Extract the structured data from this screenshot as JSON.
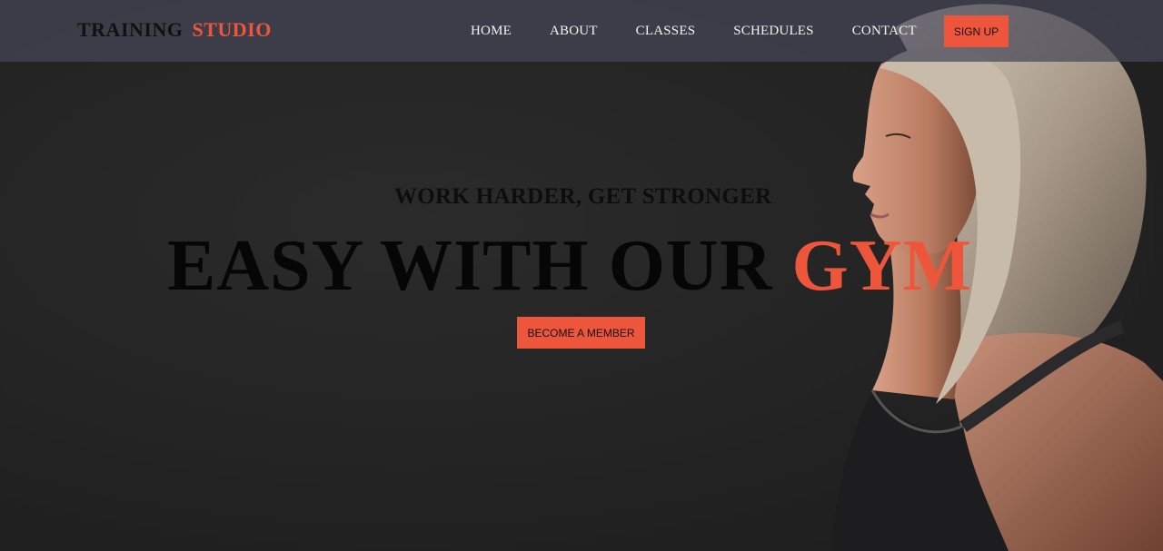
{
  "logo": {
    "part1": "TRAINING",
    "part2": "STUDIO"
  },
  "nav": {
    "items": [
      {
        "label": "HOME"
      },
      {
        "label": "ABOUT"
      },
      {
        "label": "CLASSES"
      },
      {
        "label": "SCHEDULES"
      },
      {
        "label": "CONTACT"
      }
    ],
    "signup_label": "SIGN UP"
  },
  "hero": {
    "subheading": "WORK HARDER, GET STRONGER",
    "headline_main": "EASY WITH OUR",
    "headline_accent": "GYM",
    "cta_label": "BECOME A MEMBER"
  },
  "colors": {
    "accent": "#ed563b",
    "background": "#232323",
    "navbar": "#464658"
  }
}
